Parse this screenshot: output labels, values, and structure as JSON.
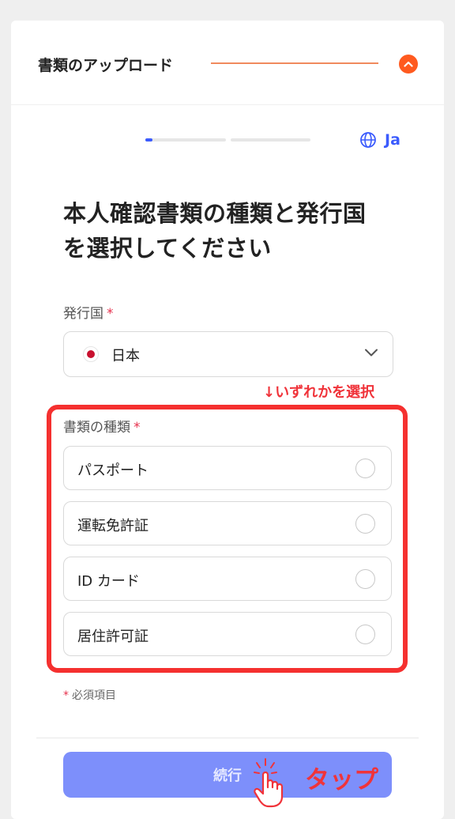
{
  "header": {
    "title": "書類のアップロード"
  },
  "progress": {
    "step": 1,
    "total_steps": 2,
    "current_step_fill_percent": 10
  },
  "language": {
    "label": "Ja",
    "icon": "globe-icon"
  },
  "page": {
    "title_line1": "本人確認書類の種類と発行国",
    "title_line2": "を選択してください"
  },
  "issuing_country": {
    "label": "発行国",
    "required_mark": "*",
    "value": "日本",
    "flag": "japan-flag-icon"
  },
  "annotation": {
    "hint": "↓いずれかを選択",
    "tap": "タップ"
  },
  "document_type": {
    "label": "書類の種類",
    "required_mark": "*",
    "options": [
      {
        "label": "パスポート"
      },
      {
        "label": "運転免許証"
      },
      {
        "label": "ID カード"
      },
      {
        "label": "居住許可証"
      }
    ]
  },
  "footer": {
    "required_mark": "*",
    "required_note": "必須項目",
    "continue_label": "続行"
  },
  "colors": {
    "accent": "#ff5a1f",
    "primary_blue": "#3b5bfd",
    "button_disabled": "#7d8ffb",
    "annotation_red": "#f5302f"
  }
}
